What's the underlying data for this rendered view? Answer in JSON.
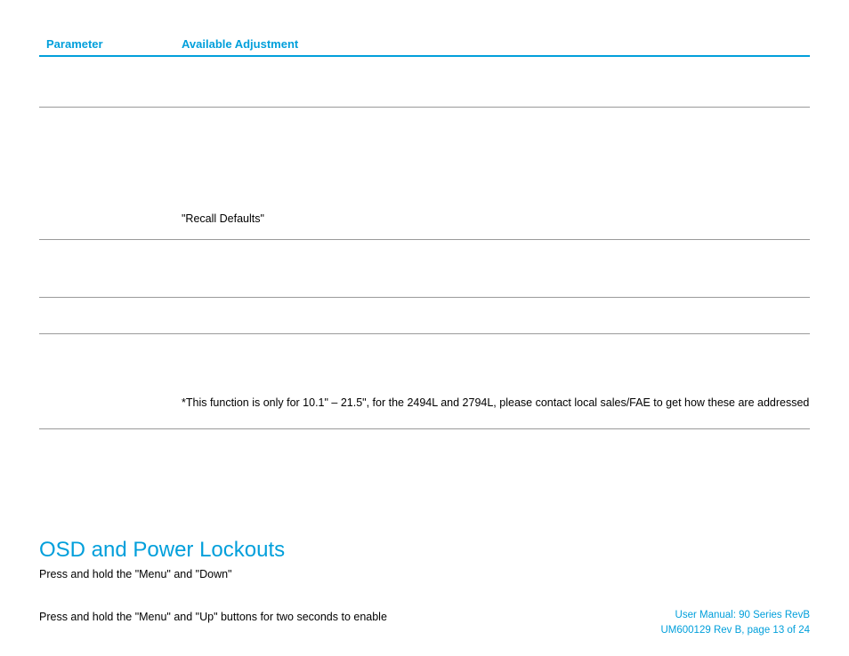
{
  "table": {
    "headers": {
      "param": "Parameter",
      "adjust": "Available Adjustment"
    },
    "recall_text": "\"Recall Defaults\"",
    "footnote": "*This function is only for 10.1\" – 21.5\", for the 2494L and 2794L, please contact local sales/FAE to get how these are addressed"
  },
  "section": {
    "heading": "OSD and Power Lockouts",
    "para1": "Press and hold the \"Menu\" and \"Down\"",
    "para2": "Press and hold the \"Menu\" and \"Up\" buttons for two seconds to enable"
  },
  "footer": {
    "line1": "User Manual: 90 Series RevB",
    "line2": "UM600129 Rev B, page 13 of 24"
  }
}
